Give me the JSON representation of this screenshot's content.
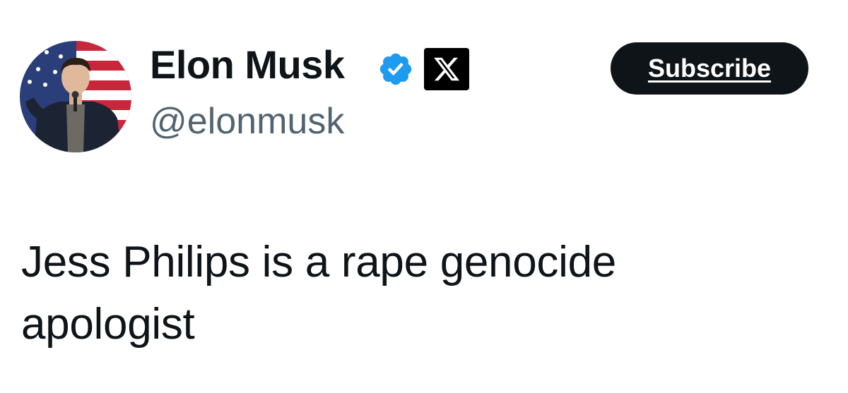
{
  "author": {
    "name": "Elon Musk",
    "handle": "@elonmusk",
    "verified": true,
    "affiliate_badge": "x-logo-icon"
  },
  "actions": {
    "subscribe_label": "Subscribe"
  },
  "tweet": {
    "text": "Jess Philips is a rape genocide apologist"
  },
  "colors": {
    "text_primary": "#0f1419",
    "text_secondary": "#536471",
    "verified_blue": "#1d9bf0",
    "button_bg": "#0f1419",
    "button_text": "#ffffff"
  }
}
